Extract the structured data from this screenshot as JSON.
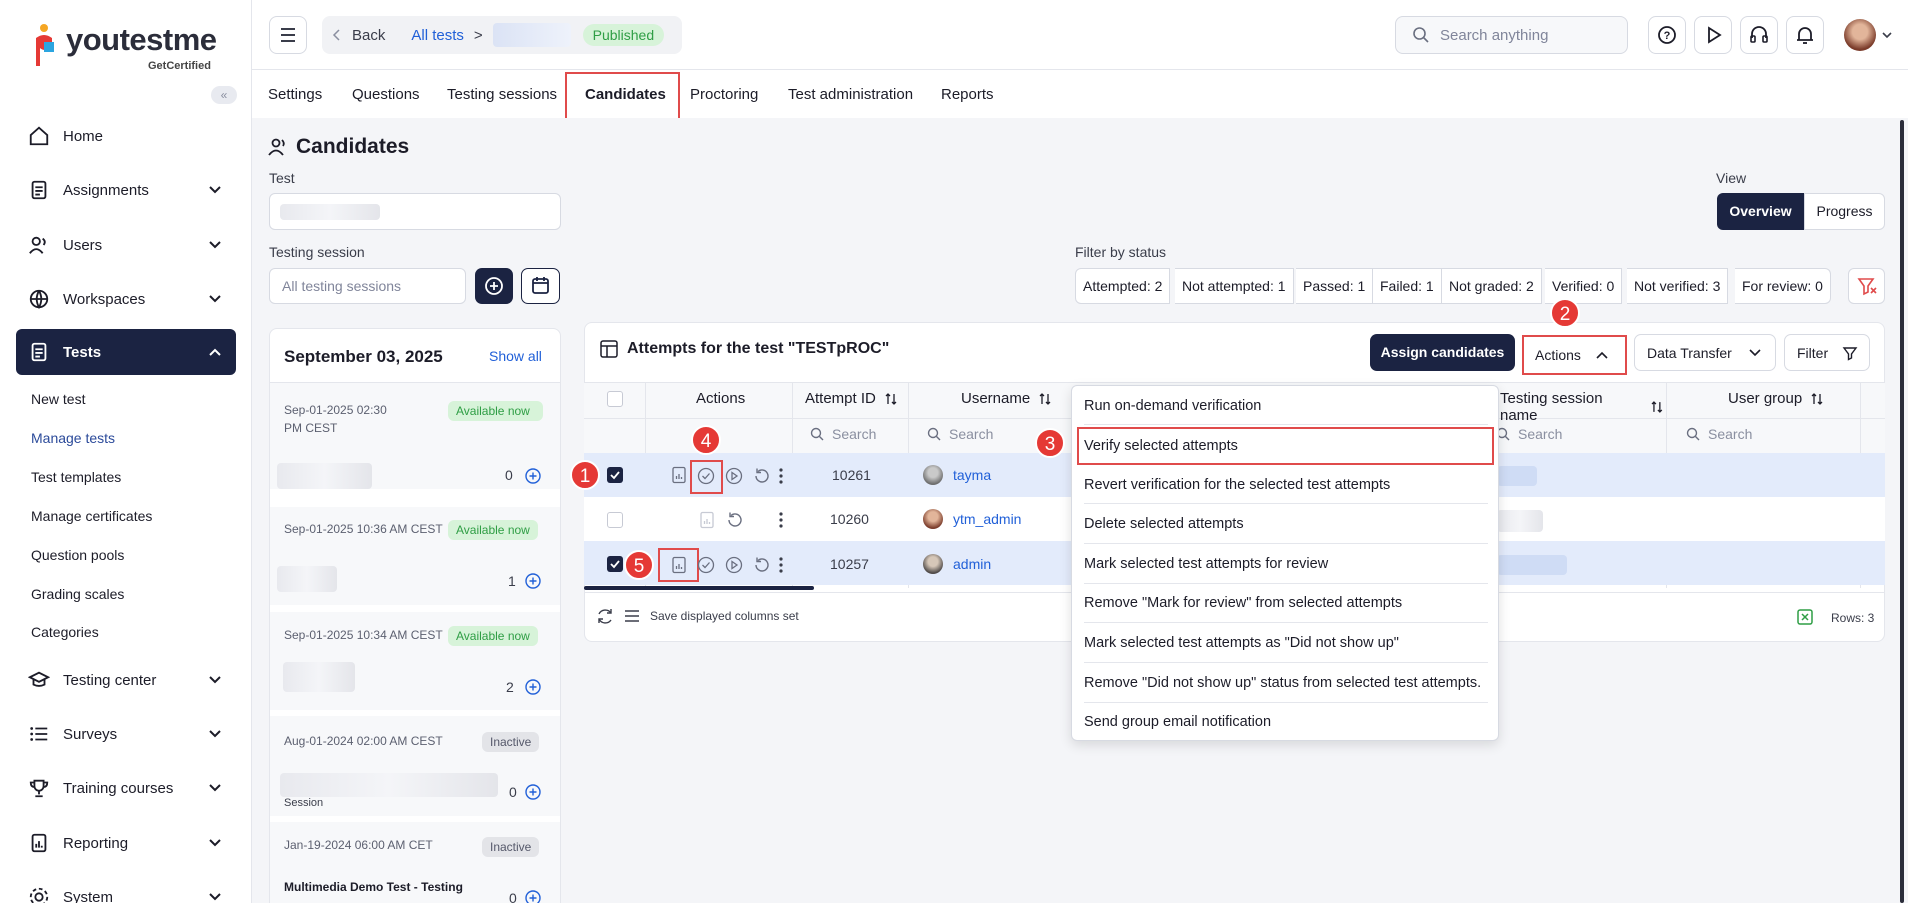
{
  "brand": {
    "name": "youtestme",
    "tagline": "GetCertified"
  },
  "sidebar": {
    "items": [
      {
        "label": "Home",
        "icon": "home-icon"
      },
      {
        "label": "Assignments",
        "icon": "document-icon"
      },
      {
        "label": "Users",
        "icon": "users-icon"
      },
      {
        "label": "Workspaces",
        "icon": "globe-icon"
      },
      {
        "label": "Tests",
        "icon": "tests-icon"
      },
      {
        "label": "Testing center",
        "icon": "graduation-cap-icon"
      },
      {
        "label": "Surveys",
        "icon": "list-icon"
      },
      {
        "label": "Training courses",
        "icon": "trophy-icon"
      },
      {
        "label": "Reporting",
        "icon": "report-icon"
      },
      {
        "label": "System",
        "icon": "gear-icon"
      }
    ],
    "tests_sub": [
      "New test",
      "Manage tests",
      "Test templates",
      "Manage certificates",
      "Question pools",
      "Grading scales",
      "Categories"
    ]
  },
  "topbar": {
    "back": "Back",
    "crumb": "All tests",
    "sep": ">",
    "status": "Published",
    "search_placeholder": "Search anything"
  },
  "tabs": [
    "Settings",
    "Questions",
    "Testing sessions",
    "Candidates",
    "Proctoring",
    "Test administration",
    "Reports"
  ],
  "page": {
    "title": "Candidates",
    "test_label": "Test",
    "session_label": "Testing session",
    "session_placeholder": "All testing sessions",
    "view_label": "View",
    "view_options": [
      "Overview",
      "Progress"
    ],
    "filter_label": "Filter by status"
  },
  "status_filters": [
    "Attempted: 2",
    "Not attempted: 1",
    "Passed: 1",
    "Failed: 1",
    "Not graded: 2",
    "Verified: 0",
    "Not verified: 3",
    "For review: 0"
  ],
  "sessions": {
    "date": "September 03, 2025",
    "show_all": "Show all",
    "list": [
      {
        "date": "Sep-01-2025 02:30 PM CEST",
        "badge": "Available now",
        "count": "0"
      },
      {
        "date": "Sep-01-2025 10:36 AM CEST",
        "badge": "Available now",
        "count": "1"
      },
      {
        "date": "Sep-01-2025 10:34 AM CEST",
        "badge": "Available now",
        "count": "2"
      },
      {
        "date": "Aug-01-2024 02:00 AM CEST",
        "badge": "Inactive",
        "count": "0",
        "name": "Session"
      },
      {
        "date": "Jan-19-2024 06:00 AM CET",
        "badge": "Inactive",
        "count": "0",
        "name": "Multimedia Demo Test - Testing"
      }
    ]
  },
  "table": {
    "title": "Attempts for the test \"TESTpROC\"",
    "assign": "Assign candidates",
    "actions": "Actions",
    "transfer": "Data Transfer",
    "filter": "Filter",
    "columns": [
      "Actions",
      "Attempt ID",
      "Username",
      "Testing session name",
      "User group"
    ],
    "search_placeholder": "Search",
    "rows": [
      {
        "id": "10261",
        "user": "tayma",
        "checked": true
      },
      {
        "id": "10260",
        "user": "ytm_admin",
        "checked": false
      },
      {
        "id": "10257",
        "user": "admin",
        "checked": true
      }
    ],
    "footer_save": "Save displayed columns set",
    "rows_count": "Rows: 3"
  },
  "actions_menu": [
    "Run on-demand verification",
    "Verify selected attempts",
    "Revert verification for the selected test attempts",
    "Delete selected attempts",
    "Mark selected test attempts for review",
    "Remove \"Mark for review\" from selected attempts",
    "Mark selected test attempts as \"Did not show up\"",
    "Remove \"Did not show up\" status from selected test attempts.",
    "Send group email notification"
  ],
  "callouts": [
    "1",
    "2",
    "3",
    "4",
    "5"
  ],
  "colors": {
    "navy": "#1b2342",
    "accent_red": "#e04b4b",
    "link": "#2160d8",
    "green": "#2f9e45"
  }
}
